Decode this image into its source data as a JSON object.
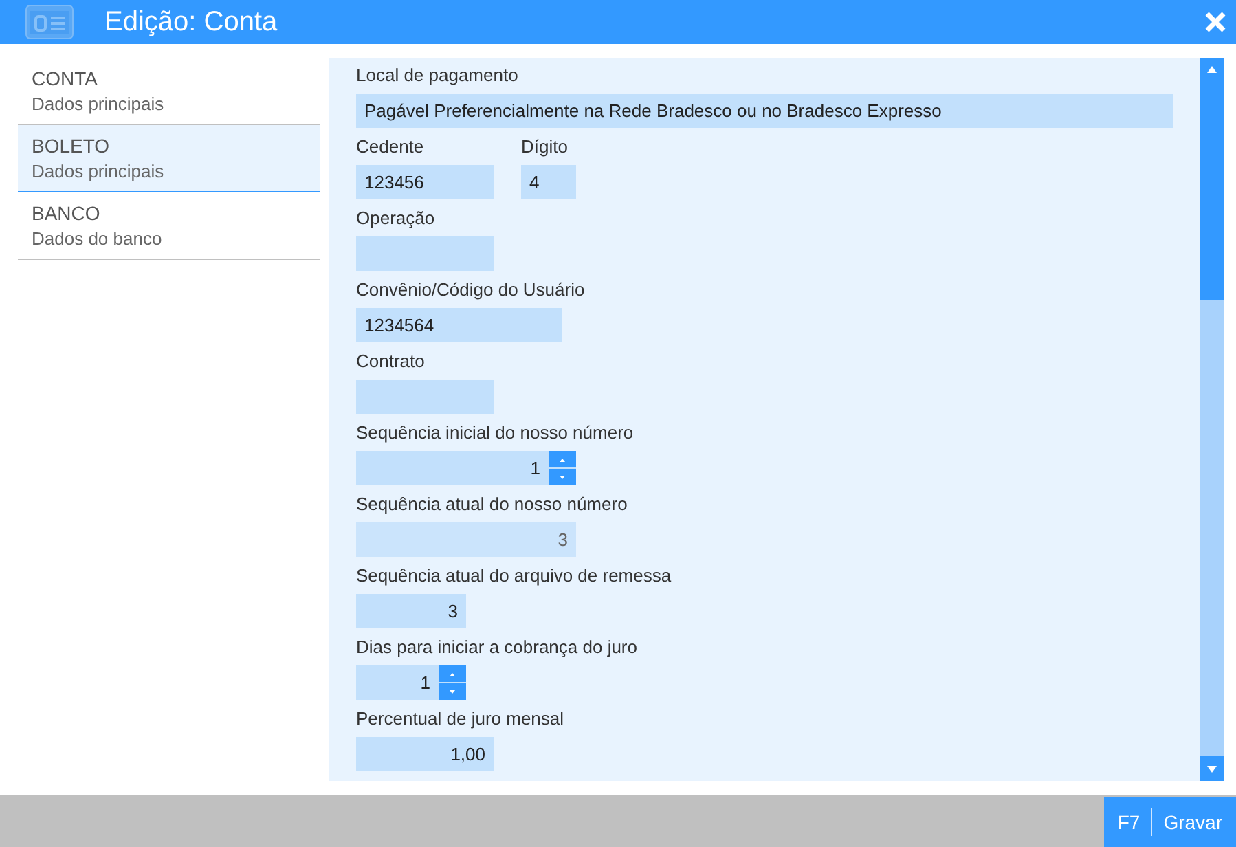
{
  "window": {
    "title": "Edição: Conta"
  },
  "sidebar": {
    "items": [
      {
        "title": "CONTA",
        "subtitle": "Dados principais",
        "selected": false
      },
      {
        "title": "BOLETO",
        "subtitle": "Dados principais",
        "selected": true
      },
      {
        "title": "BANCO",
        "subtitle": "Dados do banco",
        "selected": false
      }
    ]
  },
  "form": {
    "rows": [
      [
        {
          "label": "Local de pagamento",
          "value": "Pagável Preferencialmente na Rede Bradesco ou no Bradesco Expresso",
          "kind": "text",
          "disabled": false
        }
      ],
      [
        {
          "label": "Cedente",
          "value": "123456",
          "kind": "text",
          "disabled": false
        },
        {
          "label": "Dígito",
          "value": "4",
          "kind": "text",
          "disabled": false
        }
      ],
      [
        {
          "label": "Operação",
          "kind": "text"
        }
      ],
      [
        {
          "label": "Convênio/Código do Usuário",
          "value": "1234564",
          "kind": "text",
          "disabled": false
        }
      ],
      [
        {
          "label": "Contrato",
          "kind": "text"
        }
      ],
      [
        {
          "label": "Sequência inicial do nosso número",
          "value": "1",
          "kind": "spin",
          "disabled": false
        }
      ],
      [
        {
          "label": "Sequência atual do nosso número",
          "value": "3",
          "kind": "number",
          "disabled": true
        }
      ],
      [
        {
          "label": "Sequência atual do arquivo de remessa",
          "value": "3",
          "kind": "number",
          "disabled": false
        }
      ],
      [
        {
          "label": "Dias para iniciar a cobrança do juro",
          "value": "1",
          "kind": "spin",
          "disabled": false
        }
      ],
      [
        {
          "label": "Percentual de juro mensal",
          "value": "1,00",
          "kind": "number",
          "disabled": false
        }
      ]
    ]
  },
  "footer": {
    "shortcut": "F7",
    "button": "Gravar"
  }
}
